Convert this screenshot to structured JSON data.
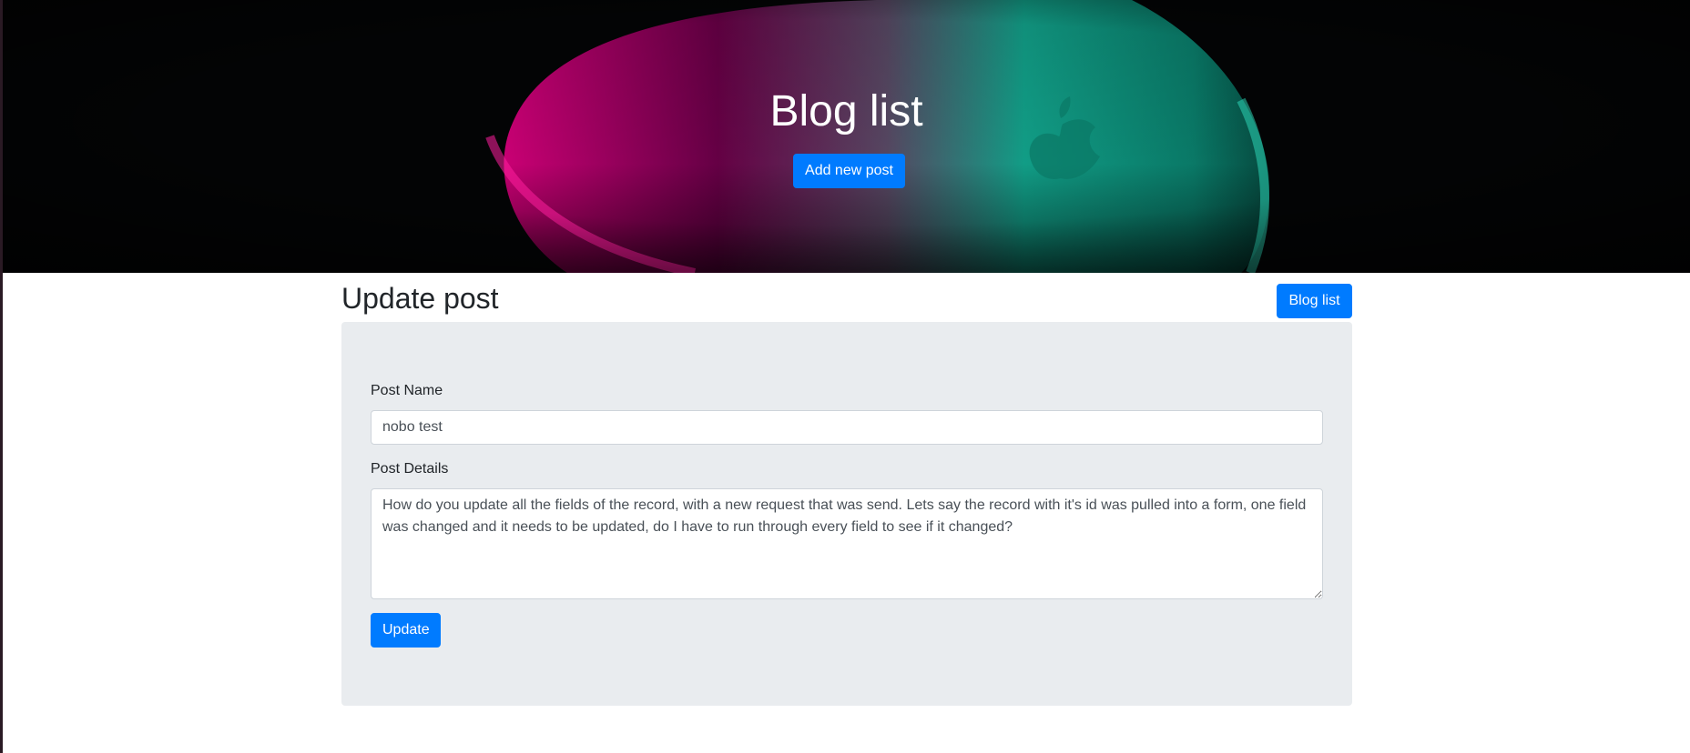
{
  "hero": {
    "title": "Blog list",
    "add_button_label": "Add new post"
  },
  "page": {
    "title": "Update post",
    "bloglist_button_label": "Blog list"
  },
  "form": {
    "post_name_label": "Post Name",
    "post_name_value": "nobo test",
    "post_details_label": "Post Details",
    "post_details_value": "How do you update all the fields of the record, with a new request that was send. Lets say the record with it's id was pulled into a form, one field was changed and it needs to be updated, do I have to run through every field to see if it changed?",
    "update_button_label": "Update"
  },
  "colors": {
    "primary": "#007bff",
    "card_background": "#e9ecef",
    "hero_background": "#030405",
    "magenta_accent": "#d4007a",
    "teal_accent": "#12a58d"
  },
  "icons": {
    "hero_image": "magic-mouse-photo",
    "hero_logo": "apple-logo-icon"
  }
}
